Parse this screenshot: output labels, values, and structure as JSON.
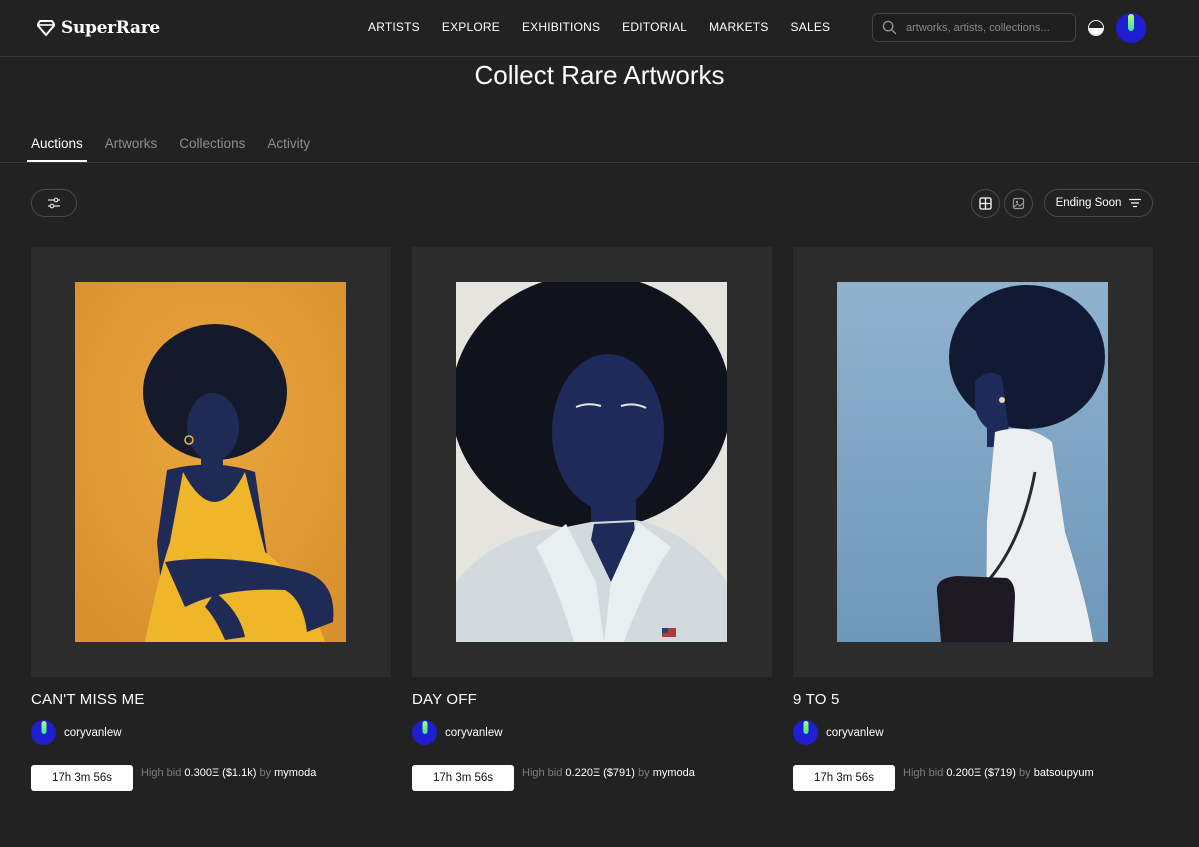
{
  "brand": {
    "name": "SuperRare"
  },
  "nav": {
    "items": [
      "ARTISTS",
      "EXPLORE",
      "EXHIBITIONS",
      "EDITORIAL",
      "MARKETS",
      "SALES"
    ]
  },
  "search": {
    "placeholder": "artworks, artists, collections..."
  },
  "page": {
    "title": "Collect Rare Artworks"
  },
  "tabs": [
    {
      "label": "Auctions",
      "active": true
    },
    {
      "label": "Artworks",
      "active": false
    },
    {
      "label": "Collections",
      "active": false
    },
    {
      "label": "Activity",
      "active": false
    }
  ],
  "toolbar": {
    "sort_label": "Ending Soon"
  },
  "cards": [
    {
      "title": "CAN'T MISS ME",
      "creator": "coryvanlew",
      "timer": "17h 3m 56s",
      "bid_prefix": "High bid",
      "bid_value": "0.300Ξ ($1.1k)",
      "bid_by": "by",
      "bidder": "mymoda"
    },
    {
      "title": "DAY OFF",
      "creator": "coryvanlew",
      "timer": "17h 3m 56s",
      "bid_prefix": "High bid",
      "bid_value": "0.220Ξ ($791)",
      "bid_by": "by",
      "bidder": "mymoda"
    },
    {
      "title": "9 TO 5",
      "creator": "coryvanlew",
      "timer": "17h 3m 56s",
      "bid_prefix": "High bid",
      "bid_value": "0.200Ξ ($719)",
      "bid_by": "by",
      "bidder": "batsoupyum"
    }
  ],
  "icons": {
    "logo": "diamond-icon",
    "search": "search-icon",
    "theme": "half-circle-icon",
    "filter": "sliders-icon",
    "grid": "grid-icon",
    "image_view": "image-icon",
    "sort": "sort-lines-icon"
  },
  "colors": {
    "background": "#222222",
    "card": "#2c2c2c",
    "avatar": "#1f1fd1",
    "art1_bg": "#e3a23a",
    "art2_bg": "#e6e4df",
    "art3_bg": "#7ea4c4"
  }
}
